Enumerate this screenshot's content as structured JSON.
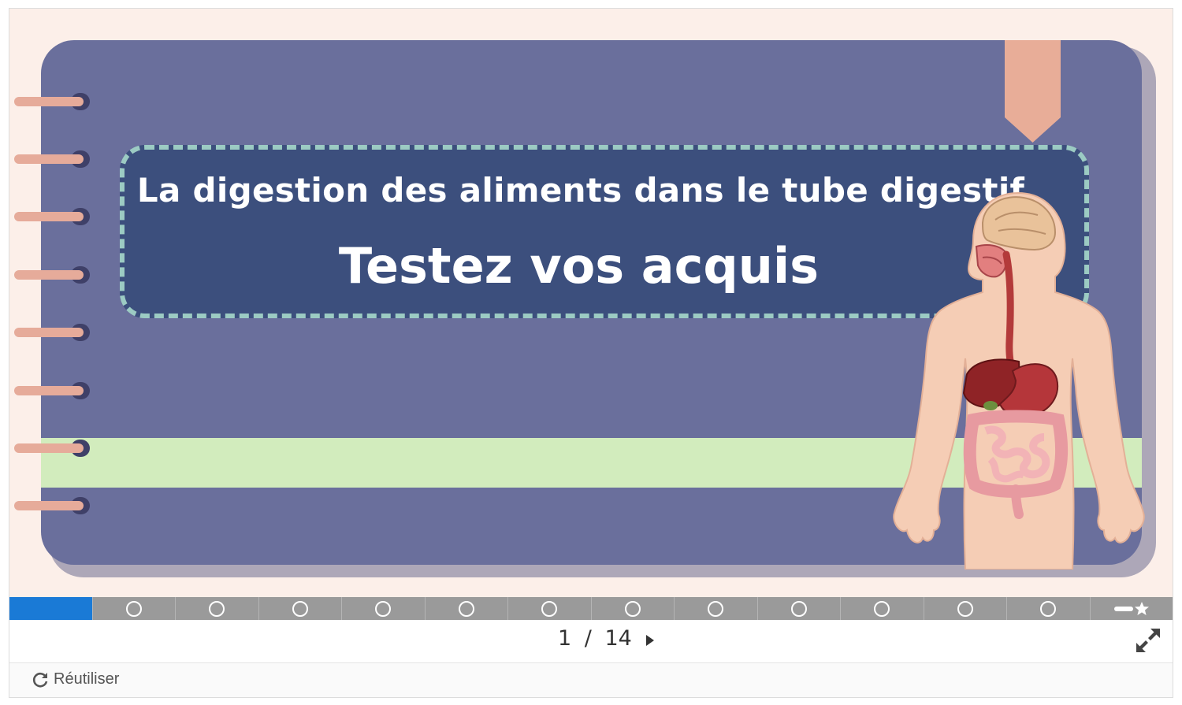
{
  "slide": {
    "subtitle": "La digestion des aliments dans le tube digestif",
    "title": "Testez vos acquis"
  },
  "progress": {
    "current": 1,
    "total": 14,
    "end_icon": "summary-star-icon"
  },
  "nav": {
    "current": "1",
    "separator": "/",
    "total": "14",
    "next_icon": "caret-right-icon",
    "fullscreen_icon": "expand-icon"
  },
  "footer": {
    "reuse_label": "Réutiliser",
    "reuse_icon": "refresh-icon"
  },
  "colors": {
    "stage_bg": "#fcefe9",
    "notebook": "#6a6f9c",
    "title_box": "#3c4f7d",
    "dashed_border": "#9ccbc3",
    "band": "#d2ecbd",
    "progress_active": "#1a7ad6"
  }
}
